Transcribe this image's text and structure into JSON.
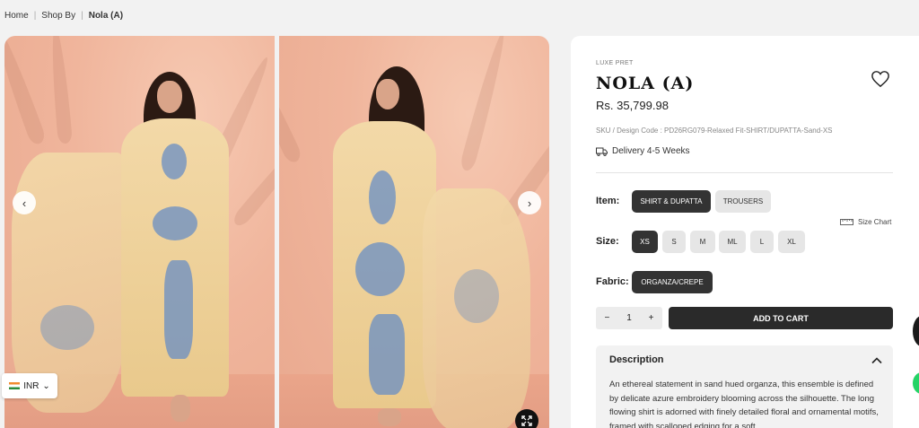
{
  "breadcrumb": {
    "home": "Home",
    "shop_by": "Shop By",
    "current": "Nola (A)"
  },
  "gallery": {
    "prev_icon": "chevron-left-icon",
    "next_icon": "chevron-right-icon",
    "expand_icon": "expand-icon",
    "prev_glyph": "‹",
    "next_glyph": "›"
  },
  "currency": {
    "code": "INR",
    "flag_icon": "india-flag-icon",
    "caret": "⌄"
  },
  "product": {
    "brand": "LUXE PRET",
    "title": "NOLA (A)",
    "price": "Rs. 35,799.98",
    "sku": "SKU / Design Code : PD26RG079-Relaxed Fit-SHIRT/DUPATTA-Sand-XS",
    "delivery": "Delivery 4-5 Weeks",
    "delivery_icon": "truck-icon",
    "wishlist_icon": "heart-icon"
  },
  "options": {
    "item_label": "Item:",
    "items": [
      {
        "label": "SHIRT & DUPATTA",
        "selected": true
      },
      {
        "label": "TROUSERS",
        "selected": false
      }
    ],
    "size_label": "Size:",
    "sizes": [
      {
        "label": "XS",
        "selected": true
      },
      {
        "label": "S",
        "selected": false
      },
      {
        "label": "M",
        "selected": false
      },
      {
        "label": "ML",
        "selected": false
      },
      {
        "label": "L",
        "selected": false
      },
      {
        "label": "XL",
        "selected": false
      }
    ],
    "size_chart": "Size Chart",
    "size_chart_icon": "ruler-icon",
    "fabric_label": "Fabric:",
    "fabrics": [
      {
        "label": "ORGANZA/CREPE",
        "selected": true
      }
    ]
  },
  "cart": {
    "minus": "−",
    "quantity": "1",
    "plus": "+",
    "add_label": "ADD TO CART"
  },
  "description": {
    "heading": "Description",
    "toggle_icon": "chevron-up-icon",
    "text": "An ethereal statement in sand hued organza, this ensemble is defined by delicate azure embroidery blooming across the silhouette. The long flowing shirt is adorned with finely detailed floral and ornamental motifs, framed with scalloped edging for a soft"
  },
  "colors": {
    "accent_dark": "#2a2a2a",
    "chip_off": "#e6e6e6",
    "embroidery_blue": "#688dc4",
    "backdrop": "#f0b59c"
  }
}
